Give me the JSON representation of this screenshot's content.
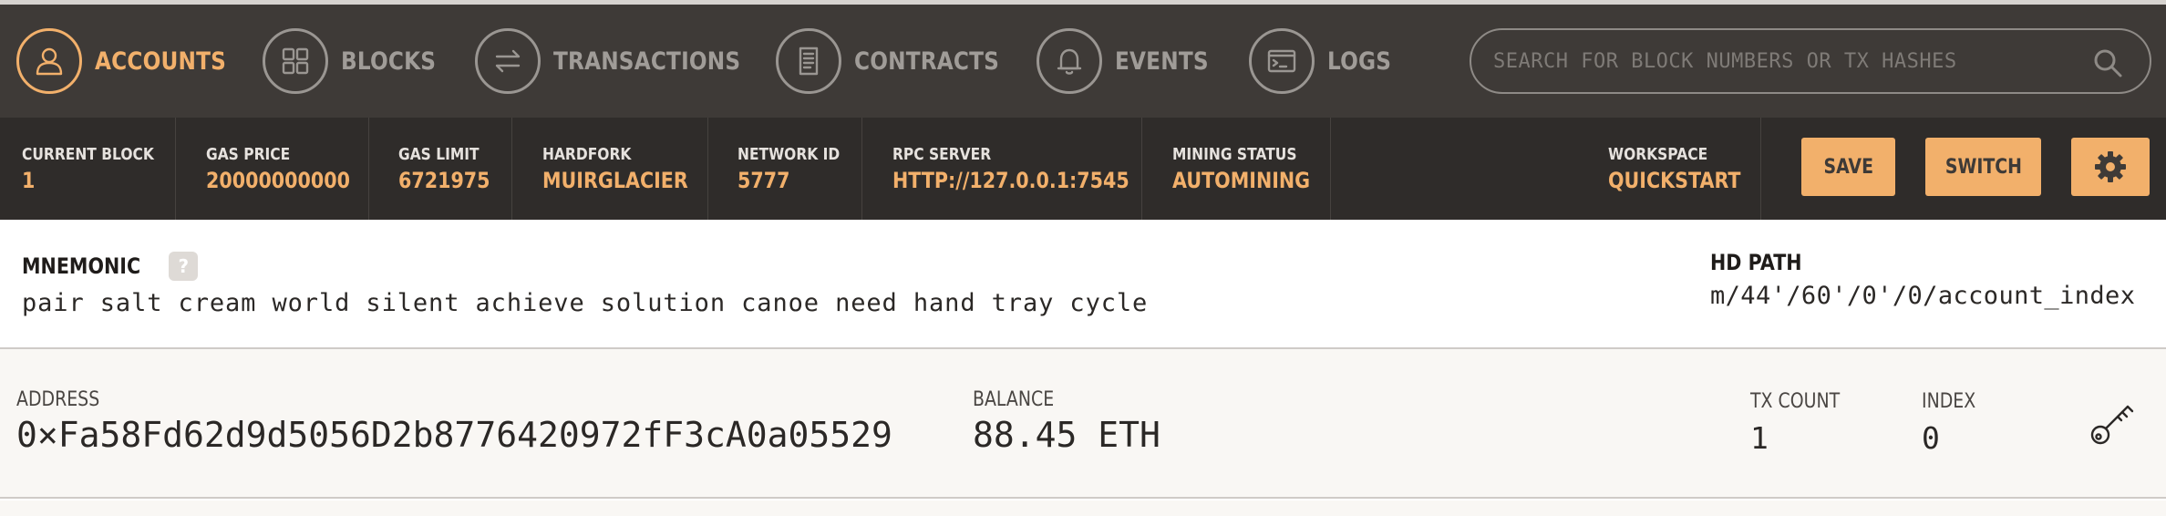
{
  "nav": {
    "items": [
      {
        "label": "ACCOUNTS",
        "icon": "person-icon",
        "active": true
      },
      {
        "label": "BLOCKS",
        "icon": "grid-icon",
        "active": false
      },
      {
        "label": "TRANSACTIONS",
        "icon": "arrows-swap-icon",
        "active": false
      },
      {
        "label": "CONTRACTS",
        "icon": "document-icon",
        "active": false
      },
      {
        "label": "EVENTS",
        "icon": "bell-icon",
        "active": false
      },
      {
        "label": "LOGS",
        "icon": "terminal-icon",
        "active": false
      }
    ],
    "search_placeholder": "SEARCH FOR BLOCK NUMBERS OR TX HASHES"
  },
  "status": {
    "current_block": {
      "label": "CURRENT BLOCK",
      "value": "1"
    },
    "gas_price": {
      "label": "GAS PRICE",
      "value": "20000000000"
    },
    "gas_limit": {
      "label": "GAS LIMIT",
      "value": "6721975"
    },
    "hardfork": {
      "label": "HARDFORK",
      "value": "MUIRGLACIER"
    },
    "network_id": {
      "label": "NETWORK ID",
      "value": "5777"
    },
    "rpc_server": {
      "label": "RPC SERVER",
      "value": "HTTP://127.0.0.1:7545"
    },
    "mining_status": {
      "label": "MINING STATUS",
      "value": "AUTOMINING"
    },
    "workspace": {
      "label": "WORKSPACE",
      "value": "QUICKSTART"
    },
    "save_label": "SAVE",
    "switch_label": "SWITCH"
  },
  "mnemonic": {
    "title": "MNEMONIC",
    "help": "?",
    "words": "pair salt cream world silent achieve solution canoe need hand tray cycle",
    "hd_path_title": "HD PATH",
    "hd_path": "m/44'/60'/0'/0/account_index"
  },
  "account": {
    "address_label": "ADDRESS",
    "address": "0×Fa58Fd62d9d5056D2b8776420972fF3cA0a05529",
    "balance_label": "BALANCE",
    "balance": "88.45 ETH",
    "tx_count_label": "TX COUNT",
    "tx_count": "1",
    "index_label": "INDEX",
    "index": "0"
  },
  "colors": {
    "accent": "#f2b06b",
    "nav_bg": "#3e3a37",
    "status_bg": "#2f2c2a"
  }
}
